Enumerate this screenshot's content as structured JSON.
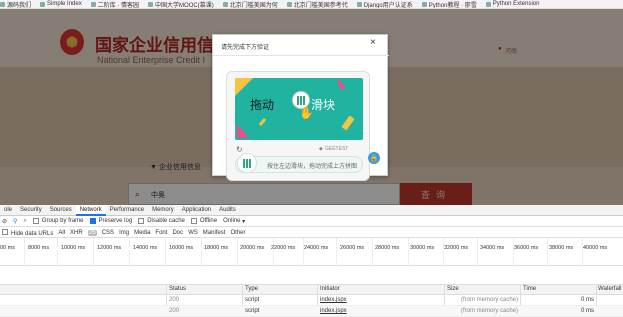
{
  "bookmarks": [
    "源码我们",
    "Simple Index",
    "二阶库 · 情客园",
    "中国大学MOOC(慕课)",
    "北京门槛美国为何",
    "北京门槛美国参考代",
    "Django用户认证系",
    "Python教程 · 廖雪",
    "Python Extension"
  ],
  "site": {
    "title": "国家企业信用信息公示系统(河南)",
    "subtitle": "National Enterprise Credit I",
    "region": "河南",
    "category": "企业信用信息",
    "search_value": "中奥",
    "search_button": "查询",
    "colors": {
      "brand": "#b3261e",
      "search_button": "#c0392b"
    }
  },
  "dialog": {
    "title": "请先完成下方验证",
    "close": "×",
    "captcha_left": "拖动",
    "captcha_right": "滑块",
    "brand": "GEETEST",
    "slider_hint": "按住左边滑块，拖动完成上方拼图",
    "icons": {
      "close": "close-icon",
      "refresh": "refresh-icon",
      "lock": "lock-icon",
      "knob": "slider-handle-icon"
    }
  },
  "devtools": {
    "tabs": [
      "ole",
      "Security",
      "Sources",
      "Network",
      "Performance",
      "Memory",
      "Application",
      "Audits"
    ],
    "active_tab": "Network",
    "toolbar": {
      "group_by_frame": "Group by frame",
      "preserve_log": "Preserve log",
      "disable_cache": "Disable cache",
      "offline": "Offline",
      "throttle": "Online"
    },
    "filters": [
      "Hide data URLs",
      "All",
      "XHR",
      "JS",
      "CSS",
      "Img",
      "Media",
      "Font",
      "Doc",
      "WS",
      "Manifest",
      "Other"
    ],
    "selected_filter": "JS",
    "ticks": [
      "00 ms",
      "8000 ms",
      "10000 ms",
      "12000 ms",
      "14000 ms",
      "16000 ms",
      "18000 ms",
      "20000 ms",
      "22000 ms",
      "24000 ms",
      "26000 ms",
      "28000 ms",
      "30000 ms",
      "32000 ms",
      "34000 ms",
      "36000 ms",
      "38000 ms",
      "40000 ms"
    ],
    "columns": [
      "Status",
      "Type",
      "Initiator",
      "Size",
      "Time",
      "Waterfall"
    ],
    "rows": [
      {
        "status": "200",
        "type": "script",
        "initiator": "index.jspx",
        "size": "(from memory cache)",
        "time": "0 ms"
      },
      {
        "status": "200",
        "type": "script",
        "initiator": "index.jspx",
        "size": "(from memory cache)",
        "time": "0 ms"
      }
    ]
  }
}
